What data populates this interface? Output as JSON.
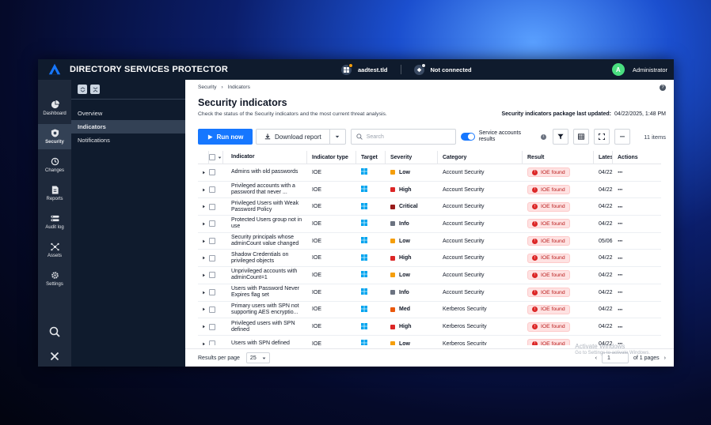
{
  "app": {
    "title": "DIRECTORY SERVICES PROTECTOR",
    "domain": "aadtest.tld",
    "connection": "Not connected",
    "user_initial": "A",
    "user_name": "Administrator",
    "accent": "#1677ff"
  },
  "rail": [
    {
      "label": "Dashboard",
      "icon": "pie-chart-icon"
    },
    {
      "label": "Security",
      "icon": "shield-icon",
      "active": true
    },
    {
      "label": "Changes",
      "icon": "history-icon"
    },
    {
      "label": "Reports",
      "icon": "report-icon"
    },
    {
      "label": "Audit log",
      "icon": "audit-log-icon"
    },
    {
      "label": "Assets",
      "icon": "assets-icon"
    },
    {
      "label": "Settings",
      "icon": "gear-icon"
    }
  ],
  "subnav": [
    {
      "label": "Overview"
    },
    {
      "label": "Indicators",
      "active": true
    },
    {
      "label": "Notifications"
    }
  ],
  "breadcrumb": {
    "root": "Security",
    "current": "Indicators"
  },
  "page": {
    "title": "Security indicators",
    "subtitle": "Check the status of the Security indicators and the most current threat analysis.",
    "updated_label": "Security indicators package last updated:",
    "updated_value": "04/22/2025, 1:48 PM"
  },
  "toolbar": {
    "run_label": "Run now",
    "download_label": "Download report",
    "search_placeholder": "Search",
    "service_accounts_label": "Service accounts results",
    "service_accounts_on": true,
    "item_count": "11 items"
  },
  "table": {
    "columns": [
      "Indicator",
      "Indicator type",
      "Target",
      "Severity",
      "Category",
      "Result",
      "Lates",
      "Actions"
    ],
    "rows": [
      {
        "indicator": "Admins with old passwords",
        "type": "IOE",
        "severity": "Low",
        "sev_color": "#f59e0b",
        "category": "Account Security",
        "result": "IOE found",
        "date": "04/22"
      },
      {
        "indicator": "Privileged accounts with a password that never ...",
        "type": "IOE",
        "severity": "High",
        "sev_color": "#dc2626",
        "category": "Account Security",
        "result": "IOE found",
        "date": "04/22"
      },
      {
        "indicator": "Privileged Users with Weak Password Policy",
        "type": "IOE",
        "severity": "Critical",
        "sev_color": "#991b1b",
        "category": "Account Security",
        "result": "IOE found",
        "date": "04/22"
      },
      {
        "indicator": "Protected Users group not in use",
        "type": "IOE",
        "severity": "Info",
        "sev_color": "#6b7280",
        "category": "Account Security",
        "result": "IOE found",
        "date": "04/22"
      },
      {
        "indicator": "Security principals whose adminCount value changed",
        "type": "IOE",
        "severity": "Low",
        "sev_color": "#f59e0b",
        "category": "Account Security",
        "result": "IOE found",
        "date": "05/06"
      },
      {
        "indicator": "Shadow Credentials on privileged objects",
        "type": "IOE",
        "severity": "High",
        "sev_color": "#dc2626",
        "category": "Account Security",
        "result": "IOE found",
        "date": "04/22"
      },
      {
        "indicator": "Unprivileged accounts with adminCount=1",
        "type": "IOE",
        "severity": "Low",
        "sev_color": "#f59e0b",
        "category": "Account Security",
        "result": "IOE found",
        "date": "04/22"
      },
      {
        "indicator": "Users with Password Never Expires flag set",
        "type": "IOE",
        "severity": "Info",
        "sev_color": "#6b7280",
        "category": "Account Security",
        "result": "IOE found",
        "date": "04/22"
      },
      {
        "indicator": "Primary users with SPN not supporting AES encryptio...",
        "type": "IOE",
        "severity": "Med",
        "sev_color": "#ea580c",
        "category": "Kerberos Security",
        "result": "IOE found",
        "date": "04/22"
      },
      {
        "indicator": "Privileged users with SPN defined",
        "type": "IOE",
        "severity": "High",
        "sev_color": "#dc2626",
        "category": "Kerberos Security",
        "result": "IOE found",
        "date": "04/22"
      },
      {
        "indicator": "Users with SPN defined",
        "type": "IOE",
        "severity": "Low",
        "sev_color": "#f59e0b",
        "category": "Kerberos Security",
        "result": "IOE found",
        "date": "04/22"
      }
    ]
  },
  "footer": {
    "rpp_label": "Results per page",
    "rpp_value": "25",
    "page_value": "1",
    "of_pages": "of 1 pages"
  },
  "watermark": {
    "title": "Activate Windows",
    "sub": "Go to Settings to activate Windows."
  }
}
